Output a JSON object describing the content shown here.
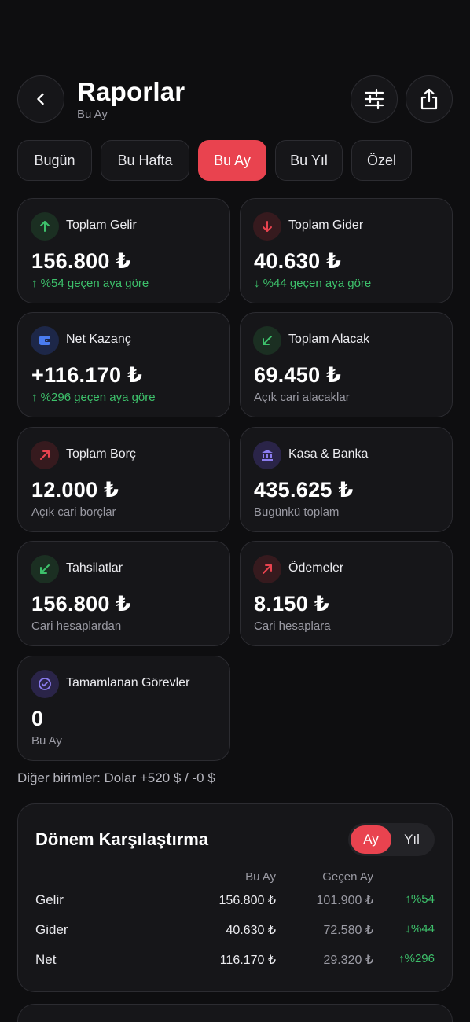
{
  "header": {
    "title": "Raporlar",
    "subtitle": "Bu Ay",
    "icons": [
      "chevron-left-icon",
      "sliders-icon",
      "share-icon"
    ]
  },
  "tabs": [
    {
      "label": "Bugün",
      "active": false
    },
    {
      "label": "Bu Hafta",
      "active": false
    },
    {
      "label": "Bu Ay",
      "active": true
    },
    {
      "label": "Bu Yıl",
      "active": false
    },
    {
      "label": "Özel",
      "active": false
    }
  ],
  "cards": [
    {
      "label": "Toplam Gelir",
      "value": "156.800 ₺",
      "note": "↑ %54 geçen aya göre",
      "note_color": "green",
      "icon": "arrow-up-icon",
      "accent": "#3dc16b"
    },
    {
      "label": "Toplam Gider",
      "value": "40.630 ₺",
      "note": "↓ %44 geçen aya göre",
      "note_color": "green",
      "icon": "arrow-down-icon",
      "accent": "#e9434f"
    },
    {
      "label": "Net Kazanç",
      "value": "+116.170 ₺",
      "note": "↑ %296 geçen aya göre",
      "note_color": "green",
      "icon": "wallet-icon",
      "accent": "#4a7cf0"
    },
    {
      "label": "Toplam Alacak",
      "value": "69.450 ₺",
      "note": "Açık cari alacaklar",
      "note_color": "gray",
      "icon": "arrow-down-left-icon",
      "accent": "#3dc16b"
    },
    {
      "label": "Toplam Borç",
      "value": "12.000 ₺",
      "note": "Açık cari borçlar",
      "note_color": "gray",
      "icon": "arrow-up-right-icon",
      "accent": "#e9434f"
    },
    {
      "label": "Kasa & Banka",
      "value": "435.625 ₺",
      "note": "Bugünkü toplam",
      "note_color": "gray",
      "icon": "bank-icon",
      "accent": "#8b7cf0"
    },
    {
      "label": "Tahsilatlar",
      "value": "156.800 ₺",
      "note": "Cari hesaplardan",
      "note_color": "gray",
      "icon": "arrow-down-left-icon",
      "accent": "#3dc16b"
    },
    {
      "label": "Ödemeler",
      "value": "8.150 ₺",
      "note": "Cari hesaplara",
      "note_color": "gray",
      "icon": "arrow-up-right-icon",
      "accent": "#e9434f"
    },
    {
      "label": "Tamamlanan Görevler",
      "value": "0",
      "note": "Bu Ay",
      "note_color": "gray",
      "icon": "check-circle-icon",
      "accent": "#8b7cf0"
    }
  ],
  "other_currencies": "Diğer birimler: Dolar +520 $ / -0 $",
  "comparison": {
    "title": "Dönem Karşılaştırma",
    "toggle": [
      {
        "label": "Ay",
        "active": true
      },
      {
        "label": "Yıl",
        "active": false
      }
    ],
    "col_current": "Bu Ay",
    "col_previous": "Geçen Ay",
    "rows": [
      {
        "label": "Gelir",
        "current": "156.800 ₺",
        "previous": "101.900 ₺",
        "change": "↑%54"
      },
      {
        "label": "Gider",
        "current": "40.630 ₺",
        "previous": "72.580 ₺",
        "change": "↓%44"
      },
      {
        "label": "Net",
        "current": "116.170 ₺",
        "previous": "29.320 ₺",
        "change": "↑%296"
      }
    ]
  }
}
